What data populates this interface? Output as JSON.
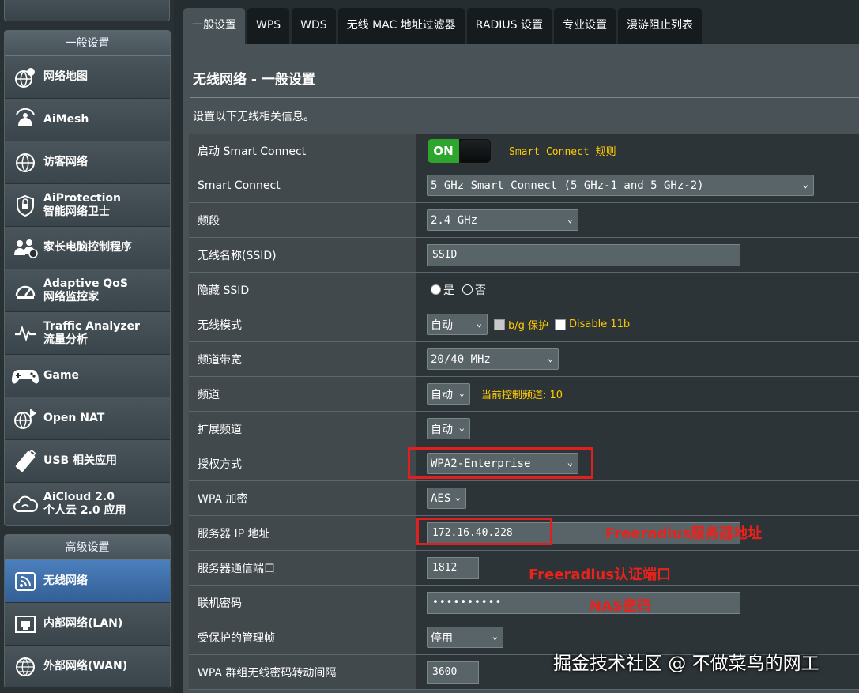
{
  "sidebar": {
    "general_header": "一般设置",
    "general_items": [
      {
        "line1": "网络地图",
        "line2": ""
      },
      {
        "line1": "AiMesh",
        "line2": ""
      },
      {
        "line1": "访客网络",
        "line2": ""
      },
      {
        "line1": "AiProtection",
        "line2": "智能网络卫士"
      },
      {
        "line1": "家长电脑控制程序",
        "line2": ""
      },
      {
        "line1": "Adaptive QoS",
        "line2": "网络监控家"
      },
      {
        "line1": "Traffic Analyzer",
        "line2": "流量分析"
      },
      {
        "line1": "Game",
        "line2": ""
      },
      {
        "line1": "Open NAT",
        "line2": ""
      },
      {
        "line1": "USB 相关应用",
        "line2": ""
      },
      {
        "line1": "AiCloud 2.0",
        "line2": "个人云 2.0 应用"
      }
    ],
    "advanced_header": "高级设置",
    "advanced_items": [
      {
        "line1": "无线网络",
        "line2": ""
      },
      {
        "line1": "内部网络(LAN)",
        "line2": ""
      },
      {
        "line1": "外部网络(WAN)",
        "line2": ""
      }
    ]
  },
  "tabs": [
    "一般设置",
    "WPS",
    "WDS",
    "无线 MAC 地址过滤器",
    "RADIUS 设置",
    "专业设置",
    "漫游阻止列表"
  ],
  "page": {
    "title": "无线网络 - 一般设置",
    "desc": "设置以下无线相关信息。"
  },
  "form": {
    "smart_connect_enable": {
      "label": "启动 Smart Connect",
      "toggle": "ON",
      "link": "Smart Connect 规则"
    },
    "smart_connect": {
      "label": "Smart Connect",
      "value": "5 GHz Smart Connect (5 GHz-1 and 5 GHz-2)"
    },
    "band": {
      "label": "频段",
      "value": "2.4 GHz"
    },
    "ssid": {
      "label": "无线名称(SSID)",
      "value": "SSID"
    },
    "hide_ssid": {
      "label": "隐藏 SSID",
      "yes": "是",
      "no": "否"
    },
    "wireless_mode": {
      "label": "无线模式",
      "value": "自动",
      "bg_protect": "b/g 保护",
      "disable_11b": "Disable 11b"
    },
    "bandwidth": {
      "label": "频道带宽",
      "value": "20/40 MHz"
    },
    "channel": {
      "label": "频道",
      "value": "自动",
      "current": "当前控制频道: 10"
    },
    "ext_channel": {
      "label": "扩展频道",
      "value": "自动"
    },
    "auth": {
      "label": "授权方式",
      "value": "WPA2-Enterprise"
    },
    "wpa_enc": {
      "label": "WPA 加密",
      "value": "AES"
    },
    "server_ip": {
      "label": "服务器 IP 地址",
      "value": "172.16.40.228",
      "annotation": "Freeradius服务器地址"
    },
    "server_port": {
      "label": "服务器通信端口",
      "value": "1812",
      "annotation": "Freeradius认证端口"
    },
    "secret": {
      "label": "联机密码",
      "value": "••••••••••",
      "annotation": "NAS密码"
    },
    "pmf": {
      "label": "受保护的管理帧",
      "value": "停用"
    },
    "rekey": {
      "label": "WPA 群组无线密码转动间隔",
      "value": "3600"
    }
  },
  "watermark": "掘金技术社区 @ 不做菜鸟的网工",
  "colors": {
    "accent_yellow": "#ffcc00",
    "annotation_red": "#e02020",
    "toggle_green": "#2ea62e",
    "active_blue": "#4b7fbd"
  }
}
